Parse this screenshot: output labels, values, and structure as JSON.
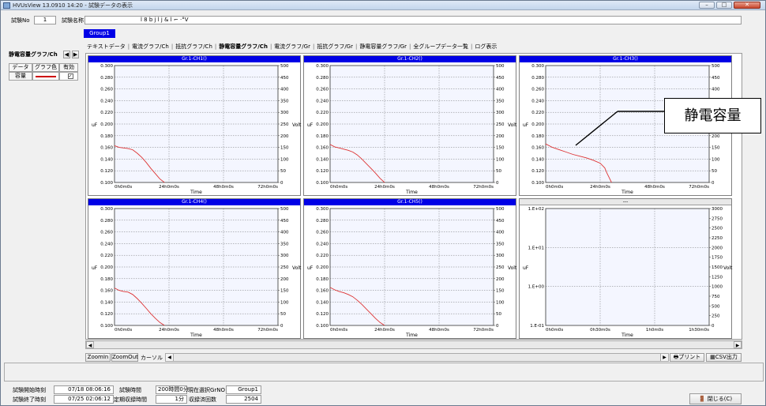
{
  "window": {
    "title": "HVUsView 13.0910 14:20 - 試験データの表示",
    "min": "–",
    "max": "□",
    "close": "✕"
  },
  "header": {
    "test_no_label": "試験No",
    "test_no_value": "1",
    "test_name_label": "試験名称",
    "test_name_value": "l  8   b  j  l  j  &  l         ⌐    ·°V"
  },
  "group_tab": "Group1",
  "tabs": [
    "テキストデータ",
    "電流グラフ/Ch",
    "抵抗グラフ/Ch",
    "静電容量グラフ/Ch",
    "電流グラフ/Gr",
    "抵抗グラフ/Gr",
    "静電容量グラフ/Gr",
    "全グループデータ一覧",
    "ログ表示"
  ],
  "active_tab_index": 3,
  "left_panel": {
    "title": "静電容量グラフ/Ch",
    "col_data": "データ",
    "col_color": "グラフ色",
    "col_enable": "有効",
    "row_label": "容量",
    "row_color": "#cc0000",
    "row_checked": "✓"
  },
  "chart_data": [
    {
      "type": "line",
      "title": "Gr.1-CH1()",
      "xlabel": "Time",
      "ylabel": "uF",
      "y2label": "Volt",
      "x_ticks": [
        "0h0m0s",
        "24h0m0s",
        "48h0m0s",
        "72h0m0s"
      ],
      "xlim": [
        0,
        72
      ],
      "ylim": [
        0.1,
        0.3
      ],
      "y2lim": [
        0,
        500
      ],
      "y_ticks": [
        "0.100",
        "0.120",
        "0.140",
        "0.160",
        "0.180",
        "0.200",
        "0.220",
        "0.240",
        "0.260",
        "0.280",
        "0.300"
      ],
      "y2_ticks": [
        "0",
        "50",
        "100",
        "150",
        "200",
        "250",
        "300",
        "350",
        "400",
        "450",
        "500"
      ],
      "grid": true,
      "line_color": "#dd3333",
      "series": [
        {
          "x": [
            0,
            2,
            4,
            6,
            8,
            10,
            12,
            14,
            16,
            18,
            20,
            22
          ],
          "y": [
            0.163,
            0.16,
            0.159,
            0.158,
            0.156,
            0.15,
            0.143,
            0.134,
            0.124,
            0.115,
            0.106,
            0.1
          ]
        }
      ]
    },
    {
      "type": "line",
      "title": "Gr.1-CH2()",
      "xlabel": "Time",
      "ylabel": "uF",
      "y2label": "Volt",
      "x_ticks": [
        "0h0m0s",
        "24h0m0s",
        "48h0m0s",
        "72h0m0s"
      ],
      "xlim": [
        0,
        72
      ],
      "ylim": [
        0.1,
        0.3
      ],
      "y2lim": [
        0,
        500
      ],
      "y_ticks": [
        "0.100",
        "0.120",
        "0.140",
        "0.160",
        "0.180",
        "0.200",
        "0.220",
        "0.240",
        "0.260",
        "0.280",
        "0.300"
      ],
      "y2_ticks": [
        "0",
        "50",
        "100",
        "150",
        "200",
        "250",
        "300",
        "350",
        "400",
        "450",
        "500"
      ],
      "grid": true,
      "line_color": "#dd3333",
      "series": [
        {
          "x": [
            0,
            2,
            4,
            6,
            8,
            10,
            12,
            14,
            16,
            18,
            20,
            22,
            24
          ],
          "y": [
            0.165,
            0.161,
            0.159,
            0.157,
            0.155,
            0.152,
            0.147,
            0.14,
            0.132,
            0.124,
            0.116,
            0.107,
            0.1
          ]
        }
      ]
    },
    {
      "type": "line",
      "title": "Gr.1-CH3()",
      "xlabel": "Time",
      "ylabel": "uF",
      "y2label": "Volt",
      "x_ticks": [
        "0h0m0s",
        "24h0m0s",
        "48h0m0s",
        "72h0m0s"
      ],
      "xlim": [
        0,
        72
      ],
      "ylim": [
        0.1,
        0.3
      ],
      "y2lim": [
        0,
        500
      ],
      "y_ticks": [
        "0.100",
        "0.120",
        "0.140",
        "0.160",
        "0.180",
        "0.200",
        "0.220",
        "0.240",
        "0.260",
        "0.280",
        "0.300"
      ],
      "y2_ticks": [
        "0",
        "50",
        "100",
        "150",
        "200",
        "250",
        "300",
        "350",
        "400",
        "450",
        "500"
      ],
      "grid": true,
      "line_color": "#dd3333",
      "series": [
        {
          "x": [
            0,
            3,
            6,
            9,
            12,
            15,
            18,
            21,
            24,
            26,
            27,
            28,
            29
          ],
          "y": [
            0.166,
            0.16,
            0.156,
            0.152,
            0.148,
            0.145,
            0.142,
            0.138,
            0.133,
            0.125,
            0.116,
            0.108,
            0.1
          ]
        }
      ]
    },
    {
      "type": "line",
      "title": "Gr.1-CH4()",
      "xlabel": "Time",
      "ylabel": "uF",
      "y2label": "Volt",
      "x_ticks": [
        "0h0m0s",
        "24h0m0s",
        "48h0m0s",
        "72h0m0s"
      ],
      "xlim": [
        0,
        72
      ],
      "ylim": [
        0.1,
        0.3
      ],
      "y2lim": [
        0,
        500
      ],
      "y_ticks": [
        "0.100",
        "0.120",
        "0.140",
        "0.160",
        "0.180",
        "0.200",
        "0.220",
        "0.240",
        "0.260",
        "0.280",
        "0.300"
      ],
      "y2_ticks": [
        "0",
        "50",
        "100",
        "150",
        "200",
        "250",
        "300",
        "350",
        "400",
        "450",
        "500"
      ],
      "grid": true,
      "line_color": "#dd3333",
      "series": [
        {
          "x": [
            0,
            2,
            4,
            6,
            8,
            10,
            12,
            14,
            16,
            18,
            20,
            22
          ],
          "y": [
            0.164,
            0.16,
            0.158,
            0.157,
            0.153,
            0.146,
            0.138,
            0.129,
            0.12,
            0.112,
            0.105,
            0.1
          ]
        }
      ]
    },
    {
      "type": "line",
      "title": "Gr.1-CH5()",
      "xlabel": "Time",
      "ylabel": "uF",
      "y2label": "Volt",
      "x_ticks": [
        "0h0m0s",
        "24h0m0s",
        "48h0m0s",
        "72h0m0s"
      ],
      "xlim": [
        0,
        72
      ],
      "ylim": [
        0.1,
        0.3
      ],
      "y2lim": [
        0,
        500
      ],
      "y_ticks": [
        "0.100",
        "0.120",
        "0.140",
        "0.160",
        "0.180",
        "0.200",
        "0.220",
        "0.240",
        "0.260",
        "0.280",
        "0.300"
      ],
      "y2_ticks": [
        "0",
        "50",
        "100",
        "150",
        "200",
        "250",
        "300",
        "350",
        "400",
        "450",
        "500"
      ],
      "grid": true,
      "line_color": "#dd3333",
      "series": [
        {
          "x": [
            0,
            2,
            4,
            6,
            8,
            10,
            12,
            14,
            16,
            18,
            20,
            22,
            24
          ],
          "y": [
            0.165,
            0.161,
            0.158,
            0.156,
            0.153,
            0.149,
            0.143,
            0.136,
            0.128,
            0.12,
            0.112,
            0.105,
            0.1
          ]
        }
      ]
    },
    {
      "type": "line",
      "title": "---",
      "xlabel": "Time",
      "ylabel": "uF",
      "y2label": "Volt",
      "x_ticks": [
        "0h0m0s",
        "0h30m0s",
        "1h0m0s",
        "1h30m0s"
      ],
      "xlim": [
        0,
        90
      ],
      "yscale": "log",
      "ylim": [
        0.1,
        100
      ],
      "y2lim": [
        0,
        3000
      ],
      "y_ticks": [
        "1.E-01",
        "1.E+00",
        "1.E+01",
        "1.E+02"
      ],
      "y2_ticks": [
        "0",
        "250",
        "500",
        "750",
        "1000",
        "1250",
        "1500",
        "1750",
        "2000",
        "2250",
        "2500",
        "2750",
        "3000"
      ],
      "grid": true,
      "line_color": "#dd3333",
      "series": []
    }
  ],
  "bottom_toolbar": {
    "zoom_in": "ZoomIn",
    "zoom_out": "ZoomOut",
    "cursor_label": "カーソル",
    "print": "プリント",
    "csv": "CSV出力"
  },
  "status": {
    "start_label": "試験開始時刻",
    "start_value": "07/18 08:06:16",
    "end_label": "試験終了時刻",
    "end_value": "07/25 02:06:12",
    "duration_label": "試験時間",
    "duration_value": "200時間0分",
    "interval_label": "定期収録時間",
    "interval_value": "1分",
    "selected_label": "現在選択GrNO",
    "selected_value": "Group1",
    "count_label": "収録済回数",
    "count_value": "2504",
    "close_button": "閉じる(C)"
  },
  "callout": "静電容量"
}
